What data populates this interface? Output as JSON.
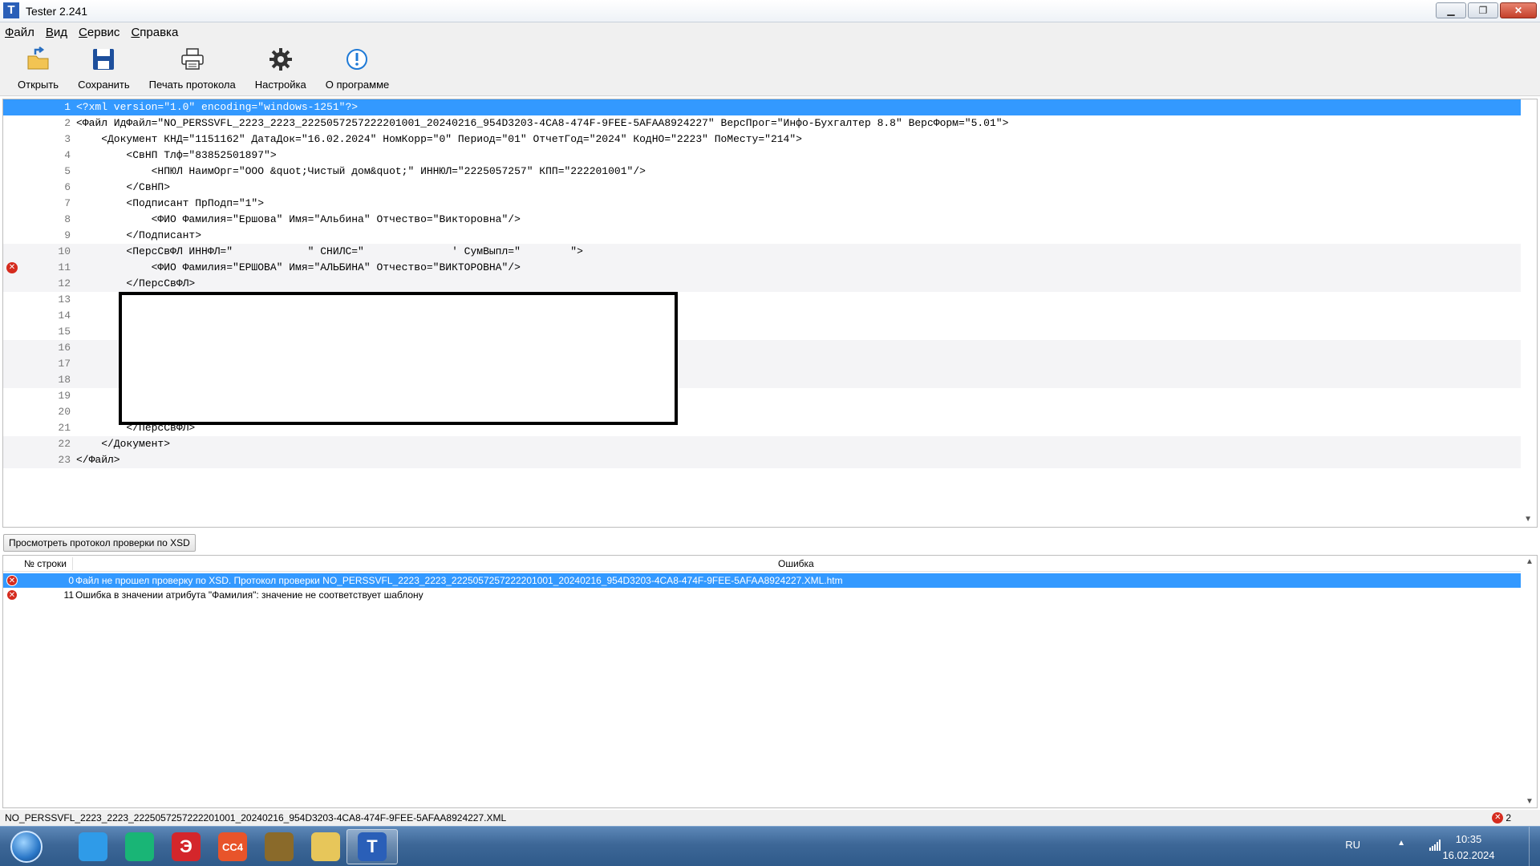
{
  "window": {
    "title": "Tester 2.241",
    "icon_letter": "T"
  },
  "menu": [
    "Файл",
    "Вид",
    "Сервис",
    "Справка"
  ],
  "toolbar": [
    {
      "id": "open",
      "label": "Открыть",
      "icon": "open-folder-icon"
    },
    {
      "id": "save",
      "label": "Сохранить",
      "icon": "floppy-icon"
    },
    {
      "id": "print",
      "label": "Печать протокола",
      "icon": "printer-icon"
    },
    {
      "id": "settings",
      "label": "Настройка",
      "icon": "gear-icon"
    },
    {
      "id": "about",
      "label": "О программе",
      "icon": "info-icon"
    }
  ],
  "editor": {
    "lines": [
      {
        "n": "1",
        "text": "<?xml version=\"1.0\" encoding=\"windows-1251\"?>",
        "selected": true
      },
      {
        "n": "2",
        "text": "<Файл ИдФайл=\"NO_PERSSVFL_2223_2223_2225057257222201001_20240216_954D3203-4CA8-474F-9FEE-5AFAA8924227\" ВерсПрог=\"Инфо-Бухгалтер 8.8\" ВерсФорм=\"5.01\">"
      },
      {
        "n": "3",
        "text": "    <Документ КНД=\"1151162\" ДатаДок=\"16.02.2024\" НомКорр=\"0\" Период=\"01\" ОтчетГод=\"2024\" КодНО=\"2223\" ПоМесту=\"214\">"
      },
      {
        "n": "4",
        "text": "        <СвНП Тлф=\"83852501897\">"
      },
      {
        "n": "5",
        "text": "            <НПЮЛ НаимОрг=\"ООО &quot;Чистый дом&quot;\" ИННЮЛ=\"2225057257\" КПП=\"222201001\"/>"
      },
      {
        "n": "6",
        "text": "        </СвНП>"
      },
      {
        "n": "7",
        "text": "        <Подписант ПрПодп=\"1\">"
      },
      {
        "n": "8",
        "text": "            <ФИО Фамилия=\"Ершова\" Имя=\"Альбина\" Отчество=\"Викторовна\"/>"
      },
      {
        "n": "9",
        "text": "        </Подписант>"
      },
      {
        "n": "10",
        "text": "        <ПерсСвФЛ ИННФЛ=\"            \" СНИЛС=\"              ' СумВыпл=\"        \">",
        "alt": true
      },
      {
        "n": "11",
        "text": "            <ФИО Фамилия=\"ЕРШОВА\" Имя=\"АЛЬБИНА\" Отчество=\"ВИКТОРОВНА\"/>",
        "alt": true,
        "error": true
      },
      {
        "n": "12",
        "text": "        </ПерсСвФЛ>",
        "alt": true
      },
      {
        "n": "13",
        "text": ""
      },
      {
        "n": "14",
        "text": ""
      },
      {
        "n": "15",
        "text": ""
      },
      {
        "n": "16",
        "text": "",
        "alt": true
      },
      {
        "n": "17",
        "text": "",
        "alt": true
      },
      {
        "n": "18",
        "text": "",
        "alt": true
      },
      {
        "n": "19",
        "text": ""
      },
      {
        "n": "20",
        "text": ""
      },
      {
        "n": "21",
        "text": "        </ПерсСвФЛ>"
      },
      {
        "n": "22",
        "text": "    </Документ>",
        "alt": true
      },
      {
        "n": "23",
        "text": "</Файл>",
        "alt": true
      }
    ]
  },
  "xsd_button": "Просмотреть протокол проверки по XSD",
  "errors": {
    "col_line": "№ строки",
    "col_error": "Ошибка",
    "rows": [
      {
        "line": "0",
        "message": "Файл не прошел проверку по XSD. Протокол проверки NO_PERSSVFL_2223_2223_2225057257222201001_20240216_954D3203-4CA8-474F-9FEE-5AFAA8924227.XML.htm",
        "selected": true
      },
      {
        "line": "11",
        "message": "Ошибка в значении атрибута \"Фамилия\": значение не соответствует шаблону"
      }
    ]
  },
  "status": {
    "file": "NO_PERSSVFL_2223_2223_2225057257222201001_20240216_954D3203-4CA8-474F-9FEE-5AFAA8924227.XML",
    "error_count": "2"
  },
  "taskbar": {
    "apps": [
      {
        "id": "messenger",
        "icon": "chat-bubble-icon",
        "color": "#2f9be8",
        "glyph": ""
      },
      {
        "id": "messenger2",
        "icon": "chat-green-icon",
        "color": "#19b576",
        "glyph": ""
      },
      {
        "id": "signature",
        "icon": "e-signature-icon",
        "color": "#d4262b",
        "glyph": "Э"
      },
      {
        "id": "cc4",
        "icon": "cc4-icon",
        "color": "#e8542a",
        "glyph": "CC4"
      },
      {
        "id": "abacus",
        "icon": "abacus-icon",
        "color": "#8a6a2a",
        "glyph": ""
      },
      {
        "id": "explorer",
        "icon": "folder-icon",
        "color": "#e7c65a",
        "glyph": ""
      },
      {
        "id": "tester",
        "icon": "tester-app-icon",
        "color": "#2a5fb8",
        "glyph": "T",
        "active": true
      }
    ],
    "lang": "RU",
    "time": "10:35",
    "date": "16.02.2024"
  }
}
